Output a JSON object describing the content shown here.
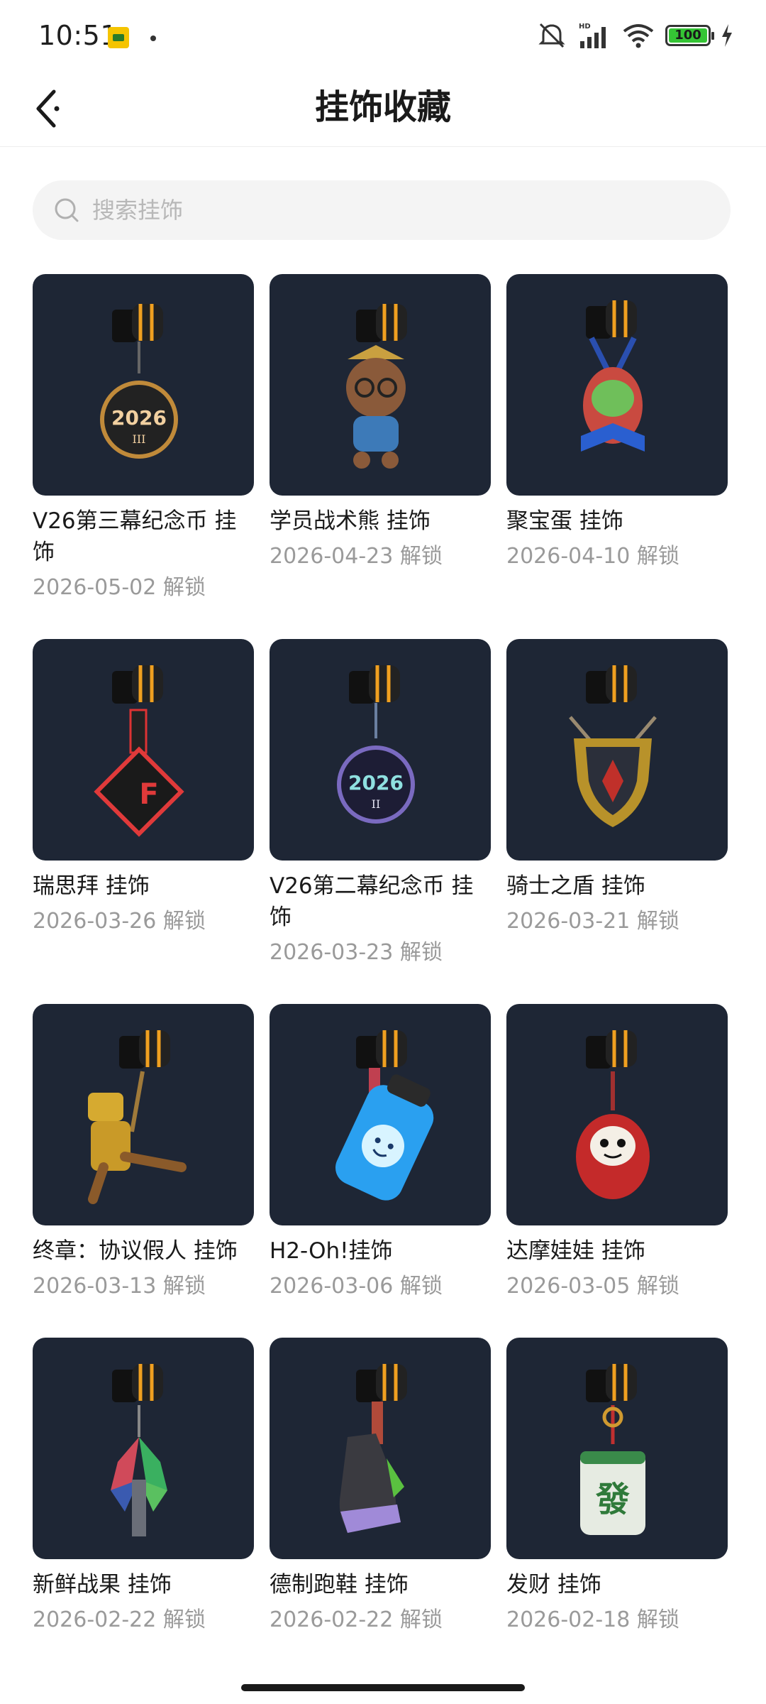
{
  "status_bar": {
    "time": "10:51",
    "battery": "100",
    "icons": [
      "app-notification-icon",
      "mute-icon",
      "signal-icon",
      "wifi-icon",
      "battery-icon",
      "charging-icon"
    ]
  },
  "header": {
    "title": "挂饰收藏",
    "back_icon": "chevron-left-icon"
  },
  "search": {
    "placeholder": "搜索挂饰",
    "value": ""
  },
  "colors": {
    "thumb_bg": "#1e2635",
    "accent_orange": "#f0a020",
    "text_primary": "#1a1a1a",
    "text_secondary": "#9a9a9a"
  },
  "items": [
    {
      "name": "V26第三幕纪念币 挂饰",
      "date": "2026-05-02 解锁",
      "icon": "coin-2026-iii-charm-icon"
    },
    {
      "name": "学员战术熊 挂饰",
      "date": "2026-04-23 解锁",
      "icon": "tactical-bear-charm-icon"
    },
    {
      "name": "聚宝蛋 挂饰",
      "date": "2026-04-10 解锁",
      "icon": "treasure-egg-charm-icon"
    },
    {
      "name": "瑞思拜 挂饰",
      "date": "2026-03-26 解锁",
      "icon": "red-cube-charm-icon"
    },
    {
      "name": "V26第二幕纪念币 挂饰",
      "date": "2026-03-23 解锁",
      "icon": "coin-2026-ii-charm-icon"
    },
    {
      "name": "骑士之盾 挂饰",
      "date": "2026-03-21 解锁",
      "icon": "knight-shield-charm-icon"
    },
    {
      "name": "终章：协议假人 挂饰",
      "date": "2026-03-13 解锁",
      "icon": "golden-dummy-charm-icon"
    },
    {
      "name": "H2-Oh!挂饰",
      "date": "2026-03-06 解锁",
      "icon": "water-bottle-charm-icon"
    },
    {
      "name": "达摩娃娃 挂饰",
      "date": "2026-03-05 解锁",
      "icon": "daruma-doll-charm-icon"
    },
    {
      "name": "新鲜战果 挂饰",
      "date": "2026-02-22 解锁",
      "icon": "fresh-spoils-charm-icon"
    },
    {
      "name": "德制跑鞋 挂饰",
      "date": "2026-02-22 解锁",
      "icon": "sneaker-charm-icon"
    },
    {
      "name": "发财 挂饰",
      "date": "2026-02-18 解锁",
      "icon": "mahjong-tile-charm-icon"
    }
  ]
}
